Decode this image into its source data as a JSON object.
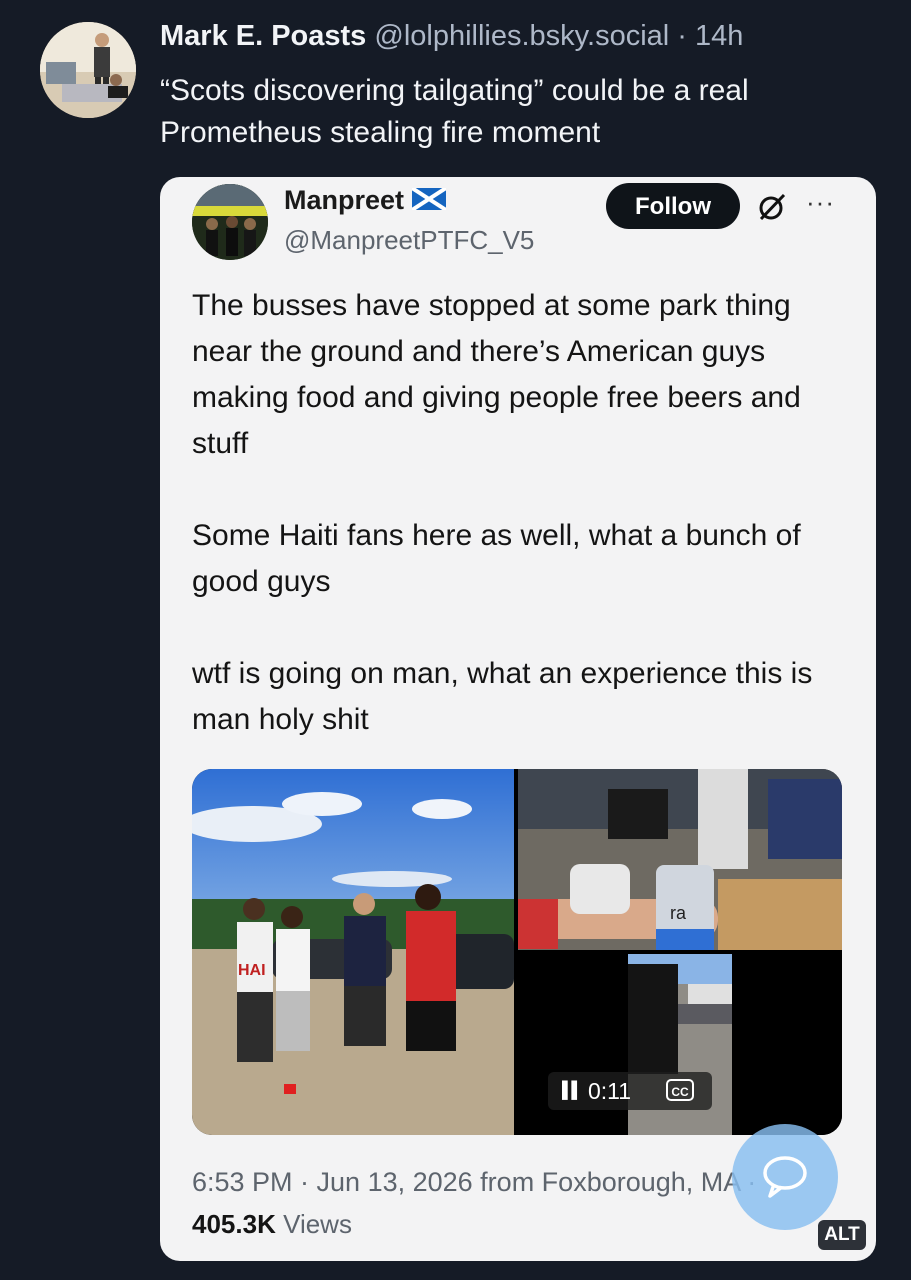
{
  "post": {
    "author_name": "Mark E. Poasts",
    "author_handle": "@lolphillies.bsky.social",
    "separator": "·",
    "time_ago": "14h",
    "text": "“Scots discovering tailgating” could be a real Prometheus stealing fire moment"
  },
  "quote": {
    "name": "Manpreet",
    "handle": "@ManpreetPTFC_V5",
    "follow_label": "Follow",
    "more_label": "···",
    "paragraphs": [
      "The busses have stopped at some park thing near the ground and there’s American guys making food and giving people free beers and stuff",
      "Some Haiti fans here as well, what a bunch of good guys",
      "wtf is going on man, what an experience this is man holy shit"
    ],
    "video_time": "0:11",
    "cc_label": "CC",
    "jersey_text": "HAI",
    "can_text": "ra",
    "timestamp": "6:53 PM · Jun 13, 2026 from Foxborough, MA ·",
    "views_count": "405.3K",
    "views_label": "Views"
  },
  "alt_badge": "ALT",
  "colors": {
    "background": "#151b26",
    "card": "#f3f3f4",
    "follow_button": "#0f1419",
    "fab": "#87bef0"
  },
  "icons": [
    "grok-icon",
    "more-icon",
    "scotland-flag-icon",
    "pause-icon",
    "cc-icon",
    "chat-bubble-icon"
  ]
}
